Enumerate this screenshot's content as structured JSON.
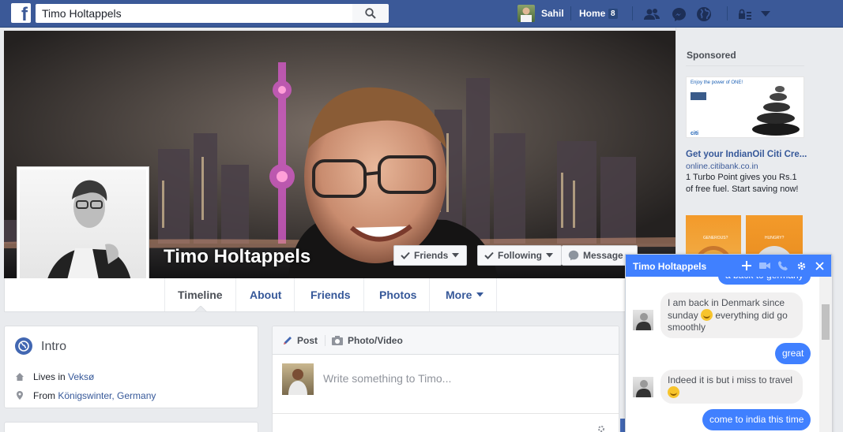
{
  "topbar": {
    "logo": "f",
    "search_value": "Timo Holtappels",
    "user_name": "Sahil",
    "home_label": "Home",
    "home_count": "8",
    "icons": [
      "friends-icon",
      "messenger-icon",
      "globe-icon",
      "lock-icon",
      "chevron-down-icon"
    ]
  },
  "profile": {
    "name": "Timo Holtappels",
    "buttons": {
      "friends": "Friends",
      "following": "Following",
      "message": "Message"
    },
    "tabs": [
      "Timeline",
      "Friends",
      "Photos",
      "More"
    ],
    "about_tab": "About"
  },
  "intro": {
    "title": "Intro",
    "lives_prefix": "Lives in ",
    "lives_place": "Veksø",
    "from_prefix": "From ",
    "from_place": "Königswinter, Germany"
  },
  "composer": {
    "post_tab": "Post",
    "photo_tab": "Photo/Video",
    "placeholder": "Write something to Timo..."
  },
  "sidebar": {
    "sponsored": "Sponsored",
    "ad1": {
      "title": "Get your IndianOil Citi Cre...",
      "url": "online.citibank.co.in",
      "desc": "1 Turbo Point gives you Rs.1 of free fuel. Start saving now!",
      "img_text": "Enjoy the power of ONE!",
      "img_brand": "citi"
    },
    "ad2": {
      "text_a": "GENEROUS?",
      "text_b": "HUNGRY?"
    }
  },
  "chat": {
    "title": "Timo Holtappels",
    "messages": [
      {
        "from": "me",
        "text": "a back to germany"
      },
      {
        "from": "them",
        "text_1": "I am back in Denmark since sunday ",
        "text_2": " everything did go smoothly"
      },
      {
        "from": "me",
        "text": "great"
      },
      {
        "from": "them",
        "text": "Indeed it is but i miss to travel"
      },
      {
        "from": "me",
        "text": "come to india this time"
      }
    ]
  },
  "colors": {
    "brand": "#3b5998",
    "chat_accent": "#4080ff",
    "link": "#365899"
  }
}
